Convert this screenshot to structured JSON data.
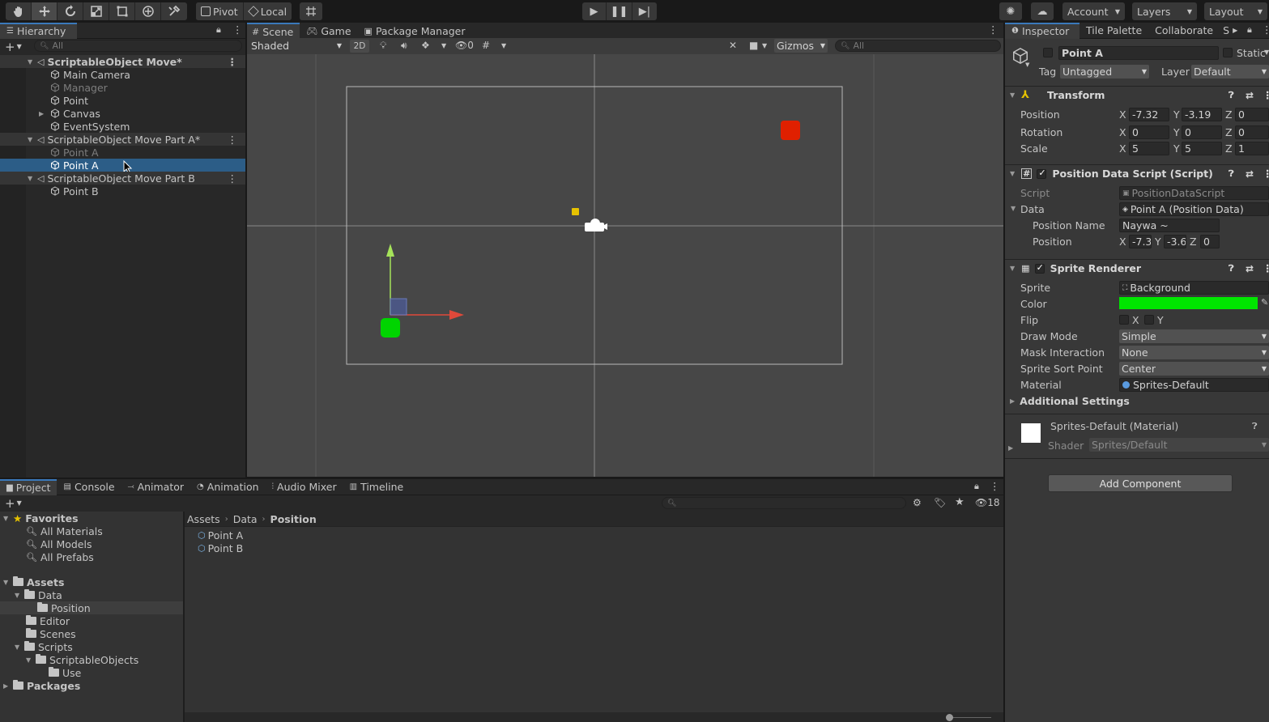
{
  "toolbar": {
    "pivot_label": "Pivot",
    "local_label": "Local",
    "account_label": "Account",
    "layers_label": "Layers",
    "layout_label": "Layout"
  },
  "hierarchy": {
    "tab_label": "Hierarchy",
    "search_placeholder": "All",
    "rows": [
      {
        "label": "ScriptableObject Move*"
      },
      {
        "label": "Main Camera"
      },
      {
        "label": "Manager"
      },
      {
        "label": "Point"
      },
      {
        "label": "Canvas"
      },
      {
        "label": "EventSystem"
      },
      {
        "label": "ScriptableObject Move Part A*"
      },
      {
        "label": "Point A"
      },
      {
        "label": "Point A"
      },
      {
        "label": "ScriptableObject Move Part B"
      },
      {
        "label": "Point B"
      }
    ]
  },
  "scene_tabs": {
    "scene": "Scene",
    "game": "Game",
    "package_manager": "Package Manager"
  },
  "scene_toolbar": {
    "shading": "Shaded",
    "mode_2d": "2D",
    "hidden_count": "0",
    "gizmos": "Gizmos",
    "search_placeholder": "All"
  },
  "inspector": {
    "tabs": {
      "inspector": "Inspector",
      "tile_palette": "Tile Palette",
      "collaborate": "Collaborate",
      "more": "S"
    },
    "object_name": "Point A",
    "static_label": "Static",
    "tag_label": "Tag",
    "tag_value": "Untagged",
    "layer_label": "Layer",
    "layer_value": "Default",
    "transform": {
      "title": "Transform",
      "position_label": "Position",
      "rotation_label": "Rotation",
      "scale_label": "Scale",
      "position": {
        "x": "-7.32",
        "y": "-3.19",
        "z": "0"
      },
      "rotation": {
        "x": "0",
        "y": "0",
        "z": "0"
      },
      "scale": {
        "x": "5",
        "y": "5",
        "z": "1"
      }
    },
    "position_script": {
      "title": "Position Data Script (Script)",
      "script_label": "Script",
      "script_value": "PositionDataScript",
      "data_label": "Data",
      "data_value": "Point A (Position Data)",
      "position_name_label": "Position Name",
      "position_name_value": "Naywa ~",
      "position_label": "Position",
      "position": {
        "x": "-7.3",
        "y": "-3.6",
        "z": "0"
      }
    },
    "sprite_renderer": {
      "title": "Sprite Renderer",
      "sprite_label": "Sprite",
      "sprite_value": "Background",
      "color_label": "Color",
      "color_value": "#00e600",
      "flip_label": "Flip",
      "flip_x": "X",
      "flip_y": "Y",
      "draw_mode_label": "Draw Mode",
      "draw_mode_value": "Simple",
      "mask_label": "Mask Interaction",
      "mask_value": "None",
      "sort_point_label": "Sprite Sort Point",
      "sort_point_value": "Center",
      "material_label": "Material",
      "material_value": "Sprites-Default",
      "additional_settings": "Additional Settings"
    },
    "material": {
      "title": "Sprites-Default (Material)",
      "shader_label": "Shader",
      "shader_value": "Sprites/Default"
    },
    "add_component": "Add Component"
  },
  "bottom_tabs": {
    "project": "Project",
    "console": "Console",
    "animator": "Animator",
    "animation": "Animation",
    "audio_mixer": "Audio Mixer",
    "timeline": "Timeline",
    "hidden_count": "18"
  },
  "project": {
    "favorites_label": "Favorites",
    "favorites": [
      "All Materials",
      "All Models",
      "All Prefabs"
    ],
    "assets_label": "Assets",
    "folders": [
      "Data",
      "Position",
      "Editor",
      "Scenes",
      "Scripts",
      "ScriptableObjects",
      "Use"
    ],
    "packages_label": "Packages",
    "breadcrumb": [
      "Assets",
      "Data",
      "Position"
    ],
    "files": [
      "Point A",
      "Point B"
    ]
  }
}
